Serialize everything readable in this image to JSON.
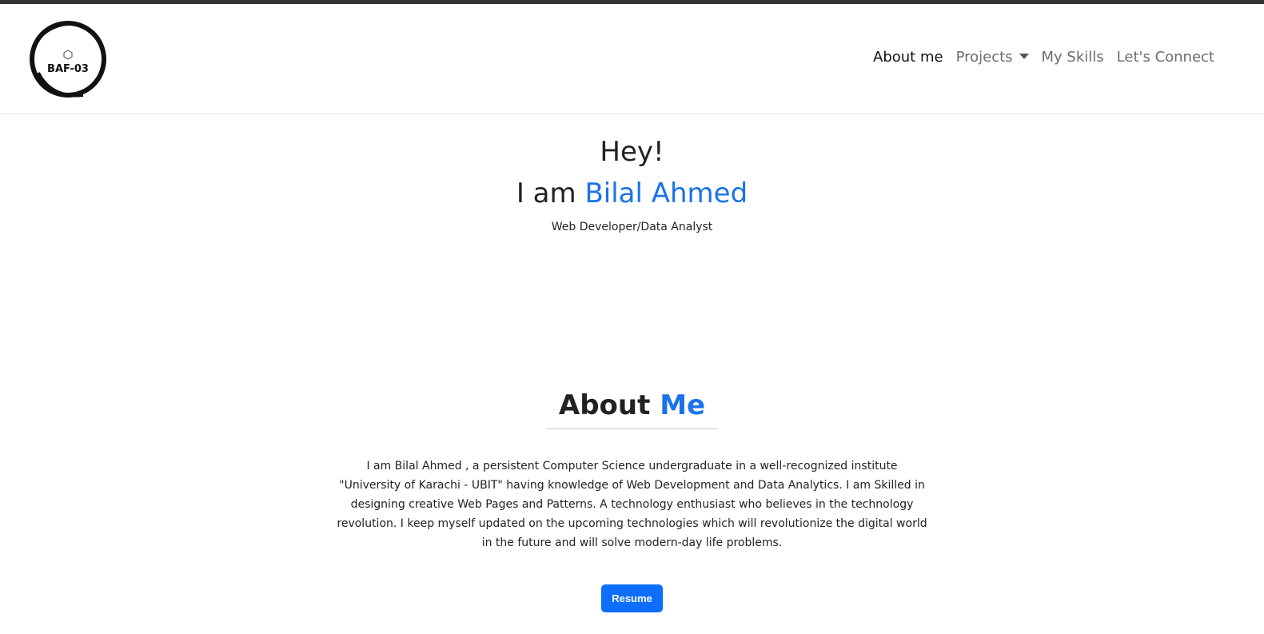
{
  "logo": {
    "text": "BAF-03"
  },
  "nav": {
    "items": [
      {
        "label": "About me",
        "active": true
      },
      {
        "label": "Projects",
        "dropdown": true
      },
      {
        "label": "My Skills"
      },
      {
        "label": "Let's Connect"
      }
    ]
  },
  "hero": {
    "greeting": "Hey!",
    "name_prefix": "I am",
    "name": "Bilal Ahmed",
    "role": "Web Developer/Data Analyst"
  },
  "about": {
    "heading_prefix": "About",
    "heading_accent": "Me",
    "text": "I am Bilal Ahmed , a persistent Computer Science undergraduate in a well-recognized institute \"University of Karachi - UBIT\" having knowledge of Web Development and Data Analytics. I am Skilled in designing creative Web Pages and Patterns. A technology enthusiast who believes in the technology revolution. I keep myself updated on the upcoming technologies which will revolutionize the digital world in the future and will solve modern-day life problems.",
    "resume_label": "Resume"
  },
  "colors": {
    "accent": "#1a73e8",
    "button": "#0d6efd",
    "topbar": "#333333"
  }
}
